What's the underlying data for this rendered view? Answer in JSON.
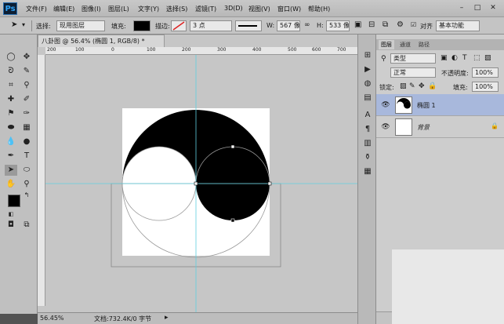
{
  "app": {
    "logo": "Ps"
  },
  "menubar": {
    "items": [
      "文件(F)",
      "编辑(E)",
      "图像(I)",
      "图层(L)",
      "文字(Y)",
      "选择(S)",
      "滤镜(T)",
      "3D(D)",
      "视图(V)",
      "窗口(W)",
      "帮助(H)"
    ],
    "window_controls": {
      "minimize": "–",
      "restore": "□",
      "close": "✕"
    }
  },
  "options": {
    "select_label": "选择:",
    "select_value": "现用图层",
    "fill_label": "填充:",
    "stroke_label": "描边:",
    "stroke_width": "3 点",
    "w_label": "W:",
    "w_value": "567 像",
    "h_label": "H:",
    "h_value": "533 像",
    "align_label": "对齐",
    "workspace": "基本功能"
  },
  "document": {
    "tab_title": "八卦图 @ 56.4% (椭圆 1, RGB/8) *",
    "ruler_labels": [
      "200",
      "100",
      "0",
      "100",
      "200",
      "300",
      "400",
      "500",
      "600",
      "700"
    ],
    "zoom": "56.45%",
    "doc_info": "文档:732.4K/0 字节"
  },
  "layers_panel": {
    "tabs": [
      "图层",
      "通道",
      "路径"
    ],
    "filter_kind": "类型",
    "blend_mode": "正常",
    "opacity_label": "不透明度:",
    "opacity_value": "100%",
    "lock_label": "锁定:",
    "fill_label": "填充:",
    "fill_value": "100%",
    "layers": [
      {
        "name": "椭圆 1",
        "selected": true
      },
      {
        "name": "背景",
        "selected": false
      }
    ],
    "footer_icons": [
      "link-icon",
      "fx-icon",
      "mask-icon",
      "adjustment-icon",
      "folder-icon",
      "new-layer-icon",
      "trash-icon"
    ]
  },
  "colors": {
    "accent_selection": "#a8b8dc",
    "guide": "#5fd0e0",
    "canvas_bg": "#c6c6c6"
  }
}
